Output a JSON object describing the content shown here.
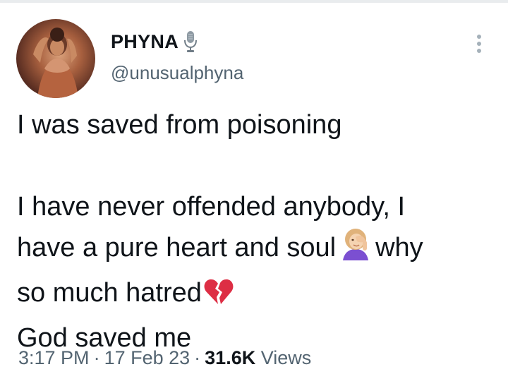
{
  "author": {
    "display_name": "PHYNA",
    "handle": "@unusualphyna"
  },
  "tweet": {
    "lines": {
      "l1": "I was saved from poisoning",
      "l2": "I have never offended anybody, I",
      "l3a": "have a pure heart and soul",
      "l3b": "why",
      "l4": "so much hatred",
      "l5": "God saved me"
    },
    "emojis": [
      "woman-facepalming-emoji",
      "broken-heart-emoji"
    ]
  },
  "meta": {
    "time": "3:17 PM",
    "separator": "·",
    "date": "17 Feb 23",
    "views_count": "31.6K",
    "views_label": "Views"
  },
  "icons": [
    "microphone-icon",
    "more-options-icon"
  ],
  "colors": {
    "text": "#0f1419",
    "secondary": "#536471",
    "divider": "#e9ecee"
  }
}
